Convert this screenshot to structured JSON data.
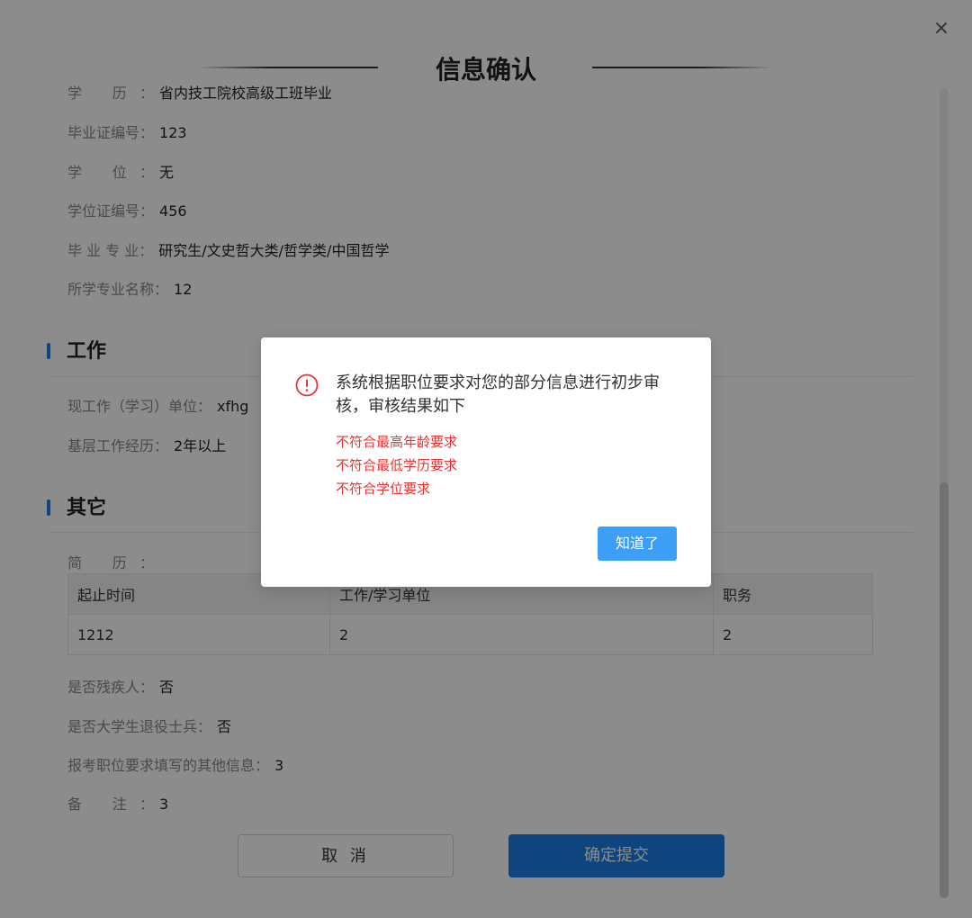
{
  "header": {
    "title": "信息确认",
    "close_label": "×"
  },
  "education": {
    "partial_row": {
      "label": "学 历：",
      "value": "省内技工院校高级工班毕业"
    },
    "rows": [
      {
        "label": "毕业证编号：",
        "value": "123"
      },
      {
        "label": "学 位：",
        "value": "无"
      },
      {
        "label": "学位证编号：",
        "value": "456"
      },
      {
        "label": "毕 业 专 业：",
        "value": "研究生/文史哲大类/哲学类/中国哲学"
      },
      {
        "label": "所学专业名称：",
        "value": "12"
      }
    ]
  },
  "work": {
    "section_title": "工作",
    "rows": [
      {
        "label": "现工作（学习）单位：",
        "value": "xfhg"
      },
      {
        "label": "基层工作经历：",
        "value": "2年以上"
      }
    ]
  },
  "other": {
    "section_title": "其它",
    "resume_label": "简 历：",
    "table": {
      "headers": [
        "起止时间",
        "工作/学习单位",
        "职务"
      ],
      "rows": [
        [
          "1212",
          "2",
          "2"
        ]
      ]
    },
    "rows": [
      {
        "label": "是否残疾人：",
        "value": "否"
      },
      {
        "label": "是否大学生退役士兵：",
        "value": "否"
      },
      {
        "label": "报考职位要求填写的其他信息：",
        "value": "3"
      },
      {
        "label": "备 注：",
        "value": "3"
      }
    ]
  },
  "buttons": {
    "cancel": "取 消",
    "submit": "确定提交"
  },
  "dialog": {
    "icon": "exclamation-circle-icon",
    "message": "系统根据职位要求对您的部分信息进行初步审核，审核结果如下",
    "errors": [
      "不符合最高年龄要求",
      "不符合最低学历要求",
      "不符合学位要求"
    ],
    "ok_label": "知道了"
  },
  "colors": {
    "accent": "#1a7ee6",
    "dialog_button": "#3d9ef5",
    "error": "#e83434"
  }
}
